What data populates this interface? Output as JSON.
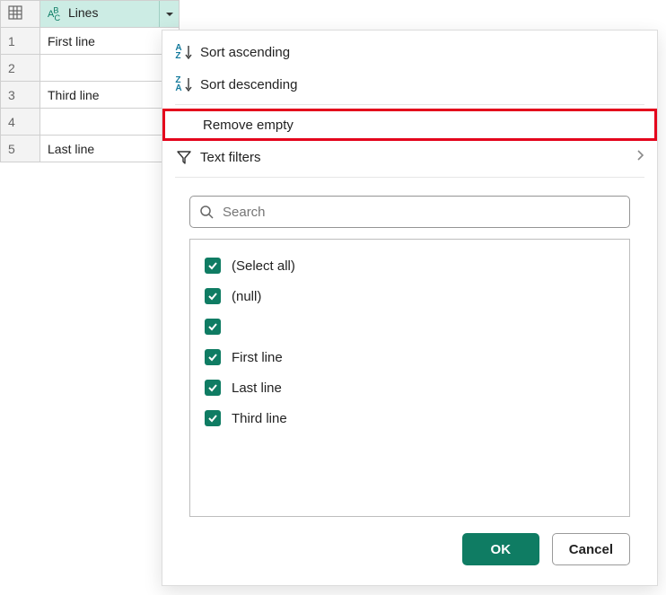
{
  "column": {
    "type_label": "ABC",
    "name": "Lines"
  },
  "rows": [
    {
      "num": "1",
      "value": "First line"
    },
    {
      "num": "2",
      "value": ""
    },
    {
      "num": "3",
      "value": "Third line"
    },
    {
      "num": "4",
      "value": ""
    },
    {
      "num": "5",
      "value": "Last line"
    }
  ],
  "menu": {
    "sort_asc": "Sort ascending",
    "sort_desc": "Sort descending",
    "remove_empty": "Remove empty",
    "text_filters": "Text filters"
  },
  "search": {
    "placeholder": "Search"
  },
  "options": {
    "select_all": "(Select all)",
    "null": "(null)",
    "blank": "",
    "v1": "First line",
    "v2": "Last line",
    "v3": "Third line"
  },
  "buttons": {
    "ok": "OK",
    "cancel": "Cancel"
  }
}
